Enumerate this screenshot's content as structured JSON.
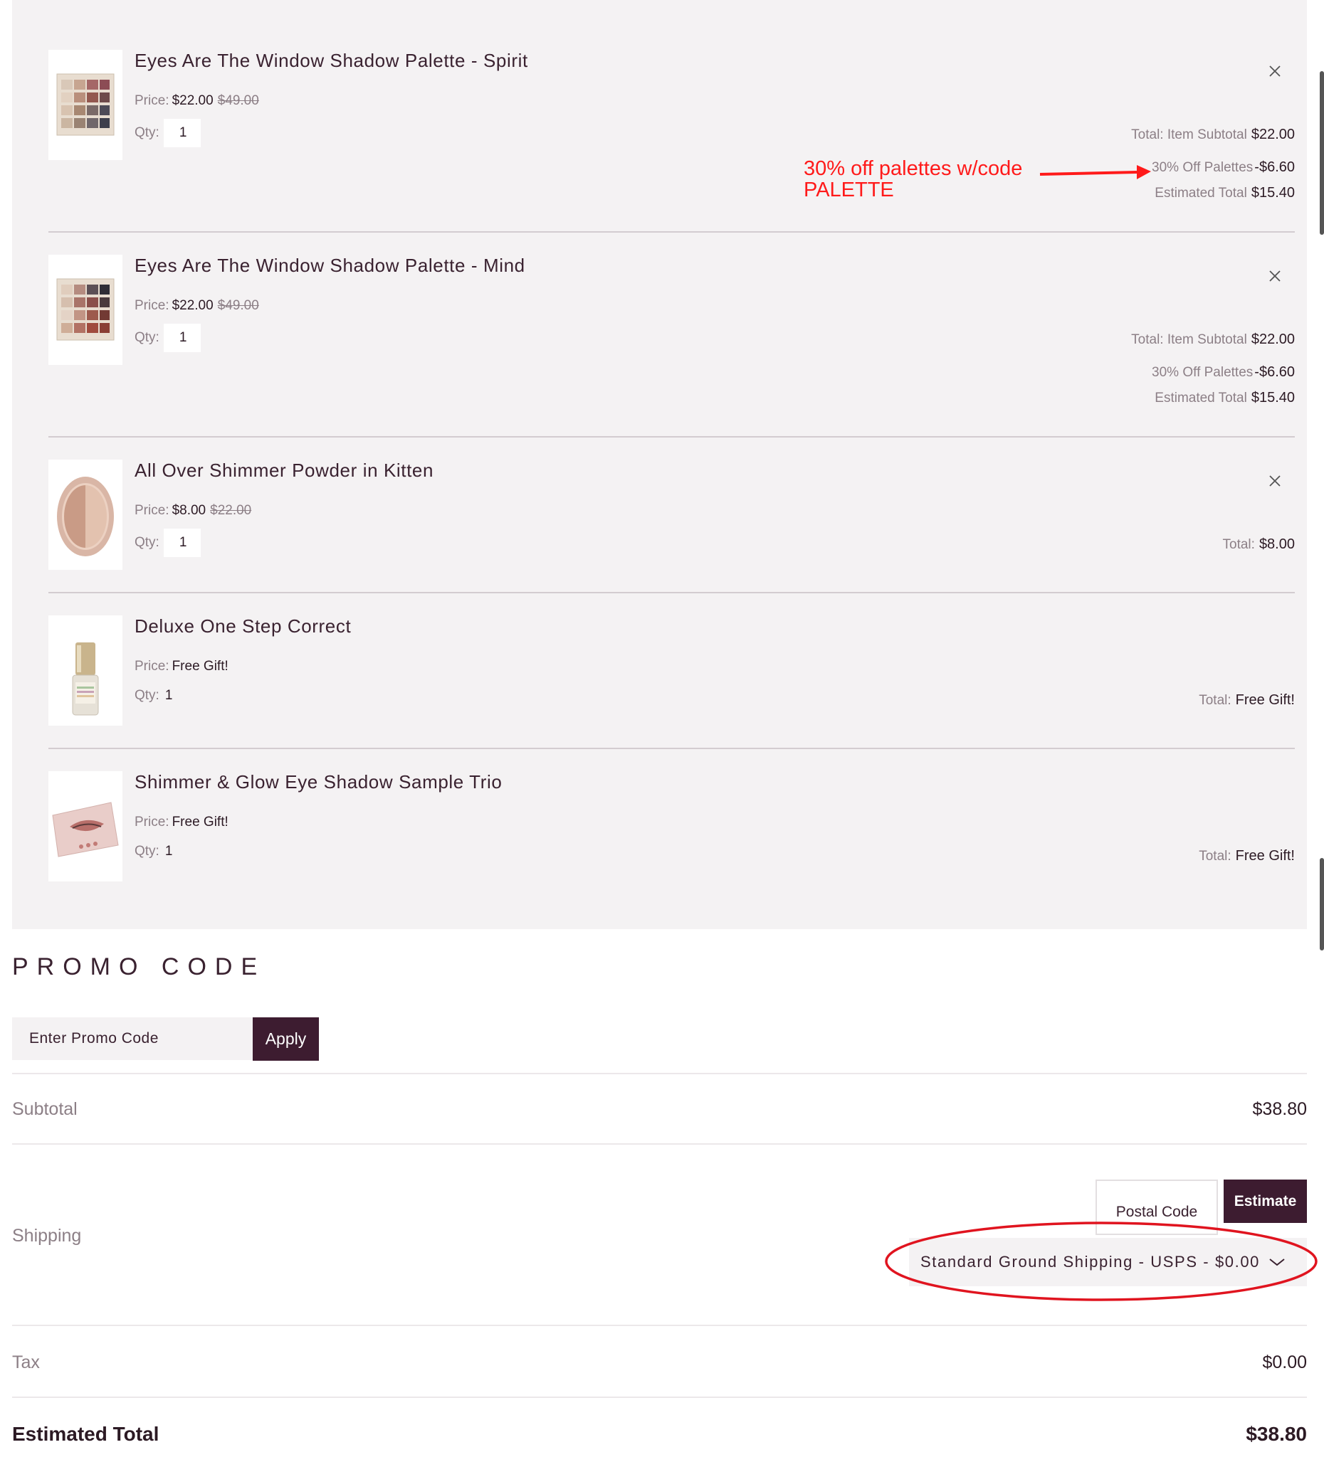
{
  "cart": {
    "items": [
      {
        "name": "Eyes Are The Window Shadow Palette - Spirit",
        "price_label": "Price:",
        "price": "$22.00",
        "original_price": "$49.00",
        "qty_label": "Qty:",
        "qty": "1",
        "totals": [
          {
            "label": "Total: Item Subtotal",
            "value": "$22.00"
          },
          {
            "label": "30% Off Palettes",
            "value": "-$6.60"
          },
          {
            "label": "Estimated Total",
            "value": "$15.40"
          }
        ]
      },
      {
        "name": "Eyes Are The Window Shadow Palette - Mind",
        "price_label": "Price:",
        "price": "$22.00",
        "original_price": "$49.00",
        "qty_label": "Qty:",
        "qty": "1",
        "totals": [
          {
            "label": "Total: Item Subtotal",
            "value": "$22.00"
          },
          {
            "label": "30% Off Palettes",
            "value": "-$6.60"
          },
          {
            "label": "Estimated Total",
            "value": "$15.40"
          }
        ]
      },
      {
        "name": "All Over Shimmer Powder in Kitten",
        "price_label": "Price:",
        "price": "$8.00",
        "original_price": "$22.00",
        "qty_label": "Qty:",
        "qty": "1",
        "totals": [
          {
            "label": "Total:",
            "value": "$8.00"
          }
        ]
      },
      {
        "name": "Deluxe One Step Correct",
        "price_label": "Price:",
        "price": "Free Gift!",
        "qty_label": "Qty:",
        "qty": "1",
        "totals": [
          {
            "label": "Total:",
            "value": "Free Gift!"
          }
        ]
      },
      {
        "name": "Shimmer & Glow Eye Shadow Sample Trio",
        "price_label": "Price:",
        "price": "Free Gift!",
        "qty_label": "Qty:",
        "qty": "1",
        "totals": [
          {
            "label": "Total:",
            "value": "Free Gift!"
          }
        ]
      }
    ]
  },
  "annotation": {
    "line1": "30% off palettes w/code",
    "line2": "PALETTE",
    "color": "#ff1a1a"
  },
  "promo": {
    "title": "PROMO CODE",
    "placeholder": "Enter Promo Code",
    "apply_label": "Apply"
  },
  "summary": {
    "subtotal_label": "Subtotal",
    "subtotal_value": "$38.80",
    "shipping_label": "Shipping",
    "postal_placeholder": "Postal Code",
    "estimate_label": "Estimate",
    "shipping_option": "Standard Ground Shipping - USPS - $0.00",
    "tax_label": "Tax",
    "tax_value": "$0.00",
    "total_label": "Estimated Total",
    "total_value": "$38.80"
  },
  "colors": {
    "brand": "#3d1c30",
    "panel": "#f4f2f3",
    "muted_text": "#8c7f86"
  },
  "icons": {
    "remove": "close-icon",
    "dropdown": "chevron-down-icon"
  }
}
